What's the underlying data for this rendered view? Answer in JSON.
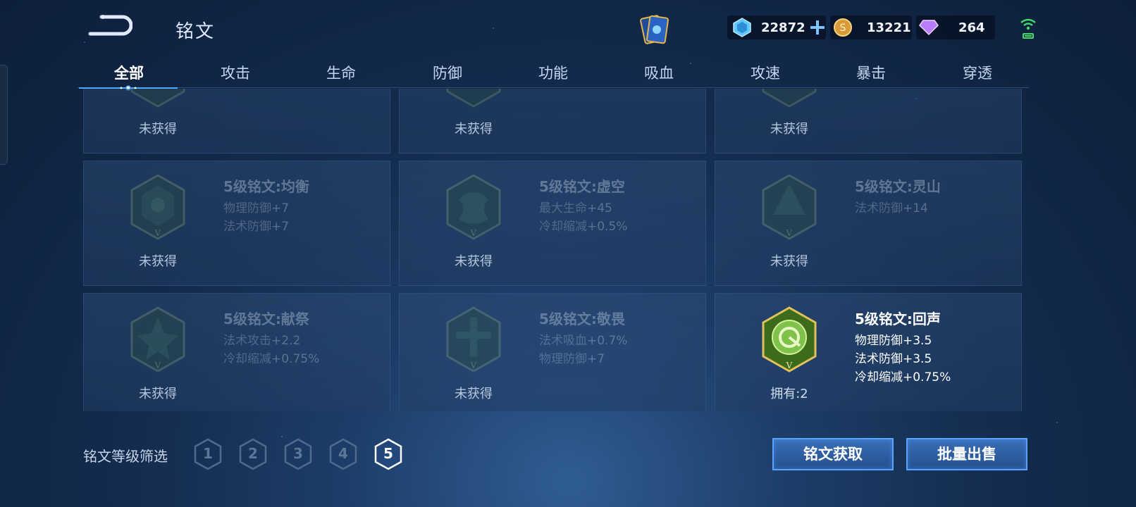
{
  "header": {
    "title": "铭文",
    "currencies": {
      "gem": "22872",
      "gold": "13221",
      "diamond": "264"
    }
  },
  "tabs": [
    "全部",
    "攻击",
    "生命",
    "防御",
    "功能",
    "吸血",
    "攻速",
    "暴击",
    "穿透"
  ],
  "active_tab": 0,
  "cards": [
    {
      "name": "",
      "attrs": [],
      "status": "未获得",
      "owned": false
    },
    {
      "name": "",
      "attrs": [],
      "status": "未获得",
      "owned": false
    },
    {
      "name": "",
      "attrs": [],
      "status": "未获得",
      "owned": false
    },
    {
      "name": "5级铭文:均衡",
      "attrs": [
        {
          "k": "物理防御",
          "v": "+7"
        },
        {
          "k": "法术防御",
          "v": "+7"
        }
      ],
      "status": "未获得",
      "owned": false
    },
    {
      "name": "5级铭文:虚空",
      "attrs": [
        {
          "k": "最大生命",
          "v": "+45"
        },
        {
          "k": "冷却缩减",
          "v": "+0.5%"
        }
      ],
      "status": "未获得",
      "owned": false
    },
    {
      "name": "5级铭文:灵山",
      "attrs": [
        {
          "k": "法术防御",
          "v": "+14"
        }
      ],
      "status": "未获得",
      "owned": false
    },
    {
      "name": "5级铭文:献祭",
      "attrs": [
        {
          "k": "法术攻击",
          "v": "+2.2"
        },
        {
          "k": "冷却缩减",
          "v": "+0.75%"
        }
      ],
      "status": "未获得",
      "owned": false
    },
    {
      "name": "5级铭文:敬畏",
      "attrs": [
        {
          "k": "法术吸血",
          "v": "+0.7%"
        },
        {
          "k": "物理防御",
          "v": "+7"
        }
      ],
      "status": "未获得",
      "owned": false
    },
    {
      "name": "5级铭文:回声",
      "attrs": [
        {
          "k": "物理防御",
          "v": "+3.5"
        },
        {
          "k": "法术防御",
          "v": "+3.5"
        },
        {
          "k": "冷却缩减",
          "v": "+0.75%"
        }
      ],
      "status": "拥有:2",
      "owned": true
    }
  ],
  "footer": {
    "filter_label": "铭文等级筛选",
    "levels": [
      "1",
      "2",
      "3",
      "4",
      "5"
    ],
    "active_level": "5",
    "acquire_button": "铭文获取",
    "sell_button": "批量出售"
  },
  "colors": {
    "accent": "#5aa2ff",
    "owned_emblem": "#7fc24a",
    "locked_emblem": "#3f6b4f"
  }
}
